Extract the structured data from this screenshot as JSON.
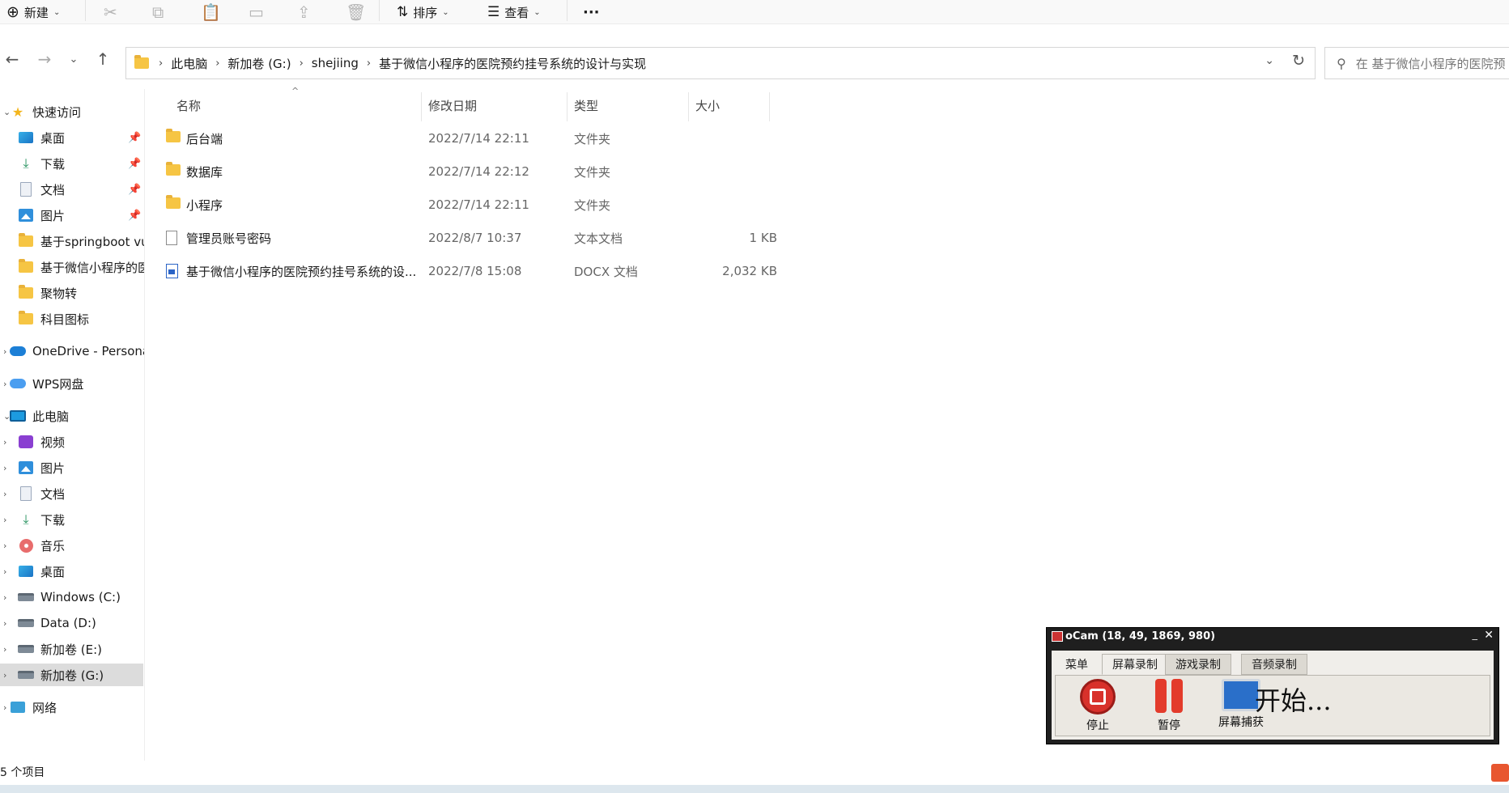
{
  "toolbar": {
    "new_label": "新建",
    "sort_label": "排序",
    "view_label": "查看",
    "more_label": "···"
  },
  "address": {
    "crumbs": [
      "此电脑",
      "新加卷 (G:)",
      "shejiing",
      "基于微信小程序的医院预约挂号系统的设计与实现"
    ],
    "search_placeholder": "在 基于微信小程序的医院预"
  },
  "sidebar": {
    "items": [
      {
        "label": "快速访问",
        "icon": "star-icon"
      },
      {
        "label": "桌面",
        "icon": "desktop-icon"
      },
      {
        "label": "下载",
        "icon": "download-icon"
      },
      {
        "label": "文档",
        "icon": "document-icon"
      },
      {
        "label": "图片",
        "icon": "pictures-icon"
      },
      {
        "label": "基于springboot vue",
        "icon": "folder-icon"
      },
      {
        "label": "基于微信小程序的医院",
        "icon": "folder-icon"
      },
      {
        "label": "聚物转",
        "icon": "folder-icon"
      },
      {
        "label": "科目图标",
        "icon": "folder-icon"
      },
      {
        "label": "OneDrive - Personal",
        "icon": "onedrive-icon"
      },
      {
        "label": "WPS网盘",
        "icon": "wps-cloud-icon"
      },
      {
        "label": "此电脑",
        "icon": "pc-icon"
      },
      {
        "label": "视频",
        "icon": "videos-icon"
      },
      {
        "label": "图片",
        "icon": "pictures-icon"
      },
      {
        "label": "文档",
        "icon": "document-icon"
      },
      {
        "label": "下载",
        "icon": "download-icon"
      },
      {
        "label": "音乐",
        "icon": "music-icon"
      },
      {
        "label": "桌面",
        "icon": "desktop-icon"
      },
      {
        "label": "Windows (C:)",
        "icon": "drive-icon"
      },
      {
        "label": "Data (D:)",
        "icon": "drive-icon"
      },
      {
        "label": "新加卷 (E:)",
        "icon": "drive-icon"
      },
      {
        "label": "新加卷 (G:)",
        "icon": "drive-icon"
      },
      {
        "label": "网络",
        "icon": "network-icon"
      }
    ]
  },
  "columns": {
    "name": "名称",
    "modified": "修改日期",
    "type": "类型",
    "size": "大小"
  },
  "files": [
    {
      "name": "后台端",
      "date": "2022/7/14 22:11",
      "type": "文件夹",
      "size": "",
      "icon": "folder-icon"
    },
    {
      "name": "数据库",
      "date": "2022/7/14 22:12",
      "type": "文件夹",
      "size": "",
      "icon": "folder-icon"
    },
    {
      "name": "小程序",
      "date": "2022/7/14 22:11",
      "type": "文件夹",
      "size": "",
      "icon": "folder-icon"
    },
    {
      "name": "管理员账号密码",
      "date": "2022/8/7 10:37",
      "type": "文本文档",
      "size": "1 KB",
      "icon": "text-file-icon"
    },
    {
      "name": "基于微信小程序的医院预约挂号系统的设...",
      "date": "2022/7/8 15:08",
      "type": "DOCX 文档",
      "size": "2,032 KB",
      "icon": "docx-file-icon"
    }
  ],
  "status": {
    "item_count": "5 个项目"
  },
  "ocam": {
    "title": "oCam (18, 49, 1869, 980)",
    "tabs": [
      "菜单",
      "屏幕录制",
      "游戏录制",
      "音频录制"
    ],
    "stop_label": "停止",
    "pause_label": "暂停",
    "capture_label": "屏幕捕获",
    "status_text": "开始..."
  }
}
